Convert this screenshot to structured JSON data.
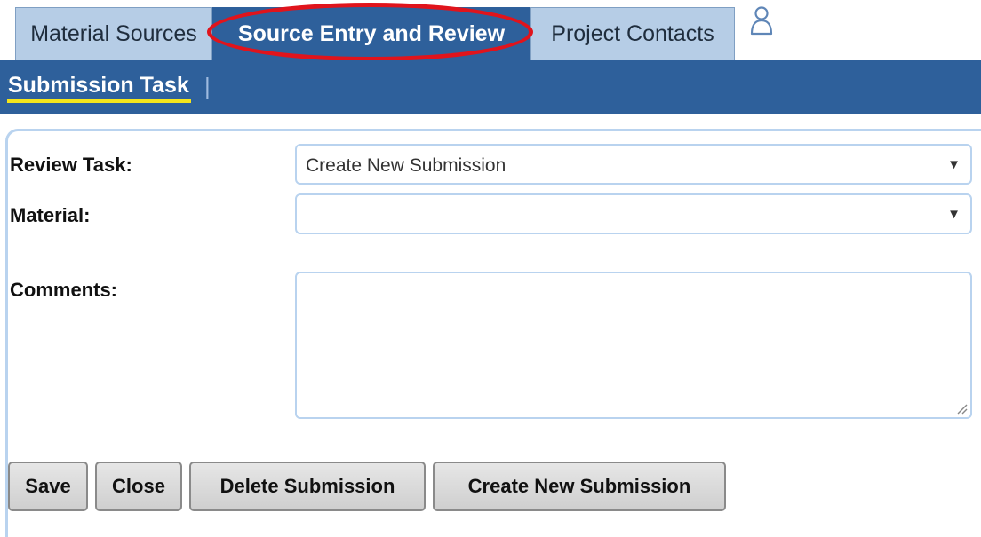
{
  "tabs": [
    {
      "label": "Material Sources",
      "active": false
    },
    {
      "label": "Source Entry and Review",
      "active": true
    },
    {
      "label": "Project Contacts",
      "active": false
    }
  ],
  "user_icon": "user-icon",
  "subnav": {
    "items": [
      {
        "label": "Submission Task"
      }
    ],
    "separator": "|"
  },
  "form": {
    "review_task": {
      "label": "Review Task:",
      "value": "Create New Submission"
    },
    "material": {
      "label": "Material:",
      "value": ""
    },
    "comments": {
      "label": "Comments:",
      "value": ""
    }
  },
  "buttons": {
    "save": "Save",
    "close": "Close",
    "delete_submission": "Delete Submission",
    "create_new_submission": "Create New Submission"
  },
  "colors": {
    "primary": "#2e609b",
    "inactive_tab": "#b6cde6",
    "highlight": "#e0141c",
    "underline": "#f5e51b",
    "field_border": "#b9d3ef"
  }
}
